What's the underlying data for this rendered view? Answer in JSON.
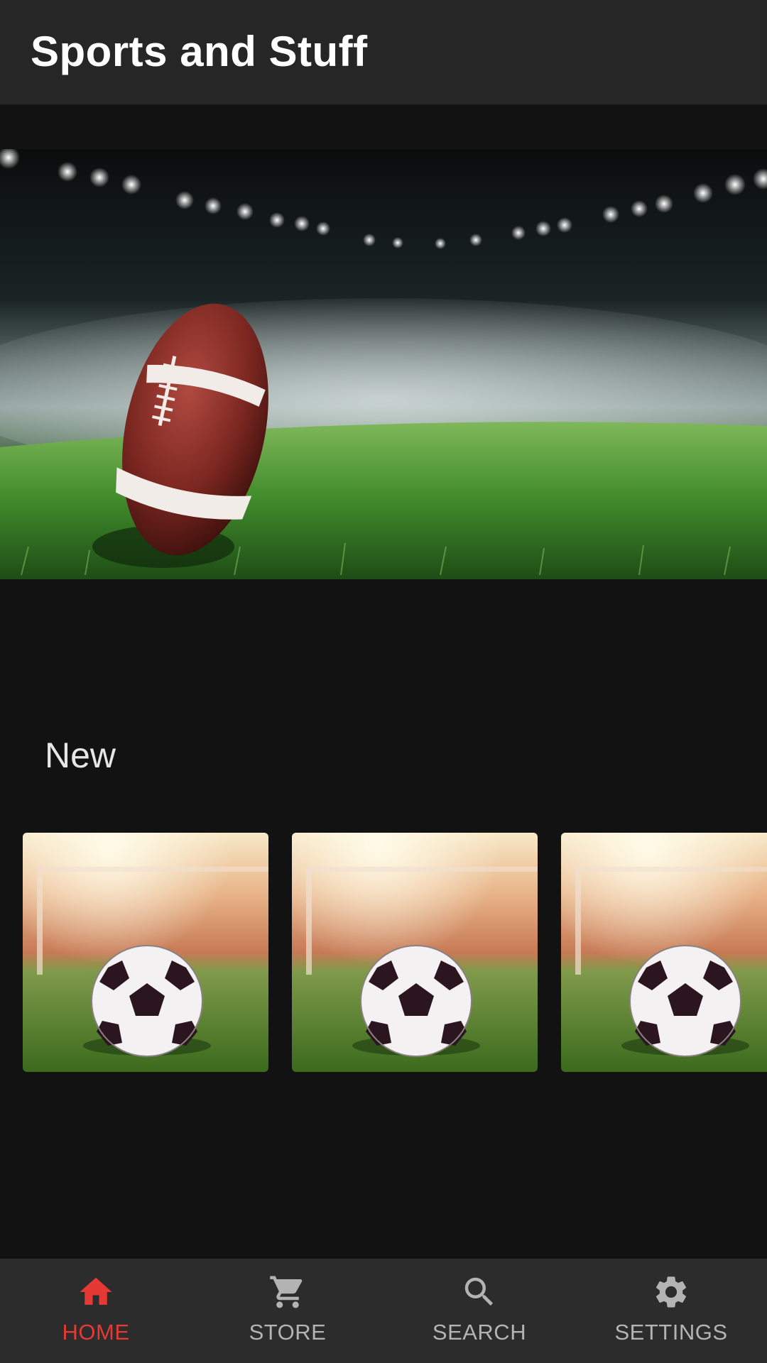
{
  "app": {
    "title": "Sports and Stuff"
  },
  "hero": {
    "image": "american-football-on-stadium-field"
  },
  "section": {
    "title": "New"
  },
  "cards": [
    {
      "image": "soccer-ball-on-grass"
    },
    {
      "image": "soccer-ball-on-grass"
    },
    {
      "image": "soccer-ball-on-grass"
    }
  ],
  "nav": {
    "items": [
      {
        "label": "HOME",
        "icon": "home-icon",
        "active": true
      },
      {
        "label": "STORE",
        "icon": "cart-icon",
        "active": false
      },
      {
        "label": "SEARCH",
        "icon": "search-icon",
        "active": false
      },
      {
        "label": "SETTINGS",
        "icon": "gear-icon",
        "active": false
      }
    ],
    "active_color": "#e53935",
    "inactive_color": "#b3b3b3"
  }
}
